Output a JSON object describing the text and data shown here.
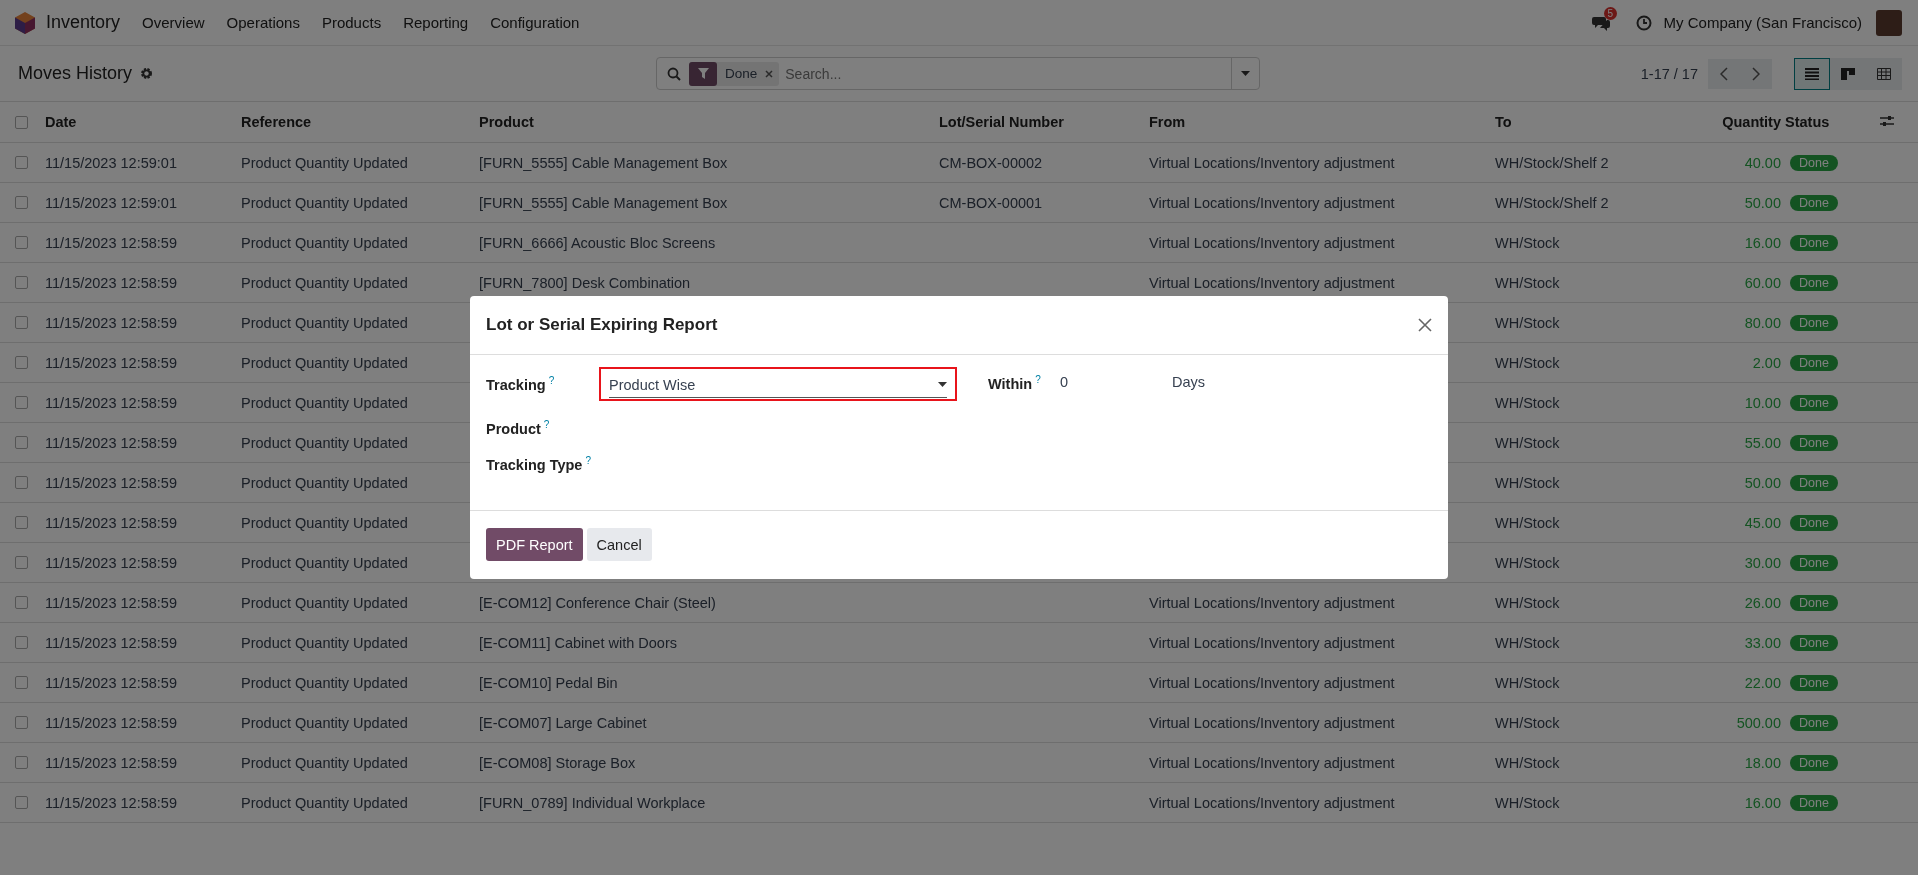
{
  "navbar": {
    "app_name": "Inventory",
    "menu": [
      "Overview",
      "Operations",
      "Products",
      "Reporting",
      "Configuration"
    ],
    "chat_count": "5",
    "company": "My Company (San Francisco)"
  },
  "control_panel": {
    "title": "Moves History",
    "search": {
      "facet": "Done",
      "placeholder": "Search..."
    },
    "pager": "1-17 / 17",
    "views": [
      {
        "kind": "list",
        "selected": true
      },
      {
        "kind": "kanban",
        "selected": false
      },
      {
        "kind": "pivot",
        "selected": false
      }
    ]
  },
  "table": {
    "all_checked": false,
    "columns": [
      "Date",
      "Reference",
      "Product",
      "Lot/Serial Number",
      "From",
      "To",
      "Quantity",
      "Status"
    ],
    "rows": [
      {
        "checked": false,
        "date": "11/15/2023 12:59:01",
        "reference": "Product Quantity Updated",
        "product": "[FURN_5555] Cable Management Box",
        "lot": "CM-BOX-00002",
        "from": "Virtual Locations/Inventory adjustment",
        "to": "WH/Stock/Shelf 2",
        "quantity": "40.00",
        "status": "Done"
      },
      {
        "checked": false,
        "date": "11/15/2023 12:59:01",
        "reference": "Product Quantity Updated",
        "product": "[FURN_5555] Cable Management Box",
        "lot": "CM-BOX-00001",
        "from": "Virtual Locations/Inventory adjustment",
        "to": "WH/Stock/Shelf 2",
        "quantity": "50.00",
        "status": "Done"
      },
      {
        "checked": false,
        "date": "11/15/2023 12:58:59",
        "reference": "Product Quantity Updated",
        "product": "[FURN_6666] Acoustic Bloc Screens",
        "from": "Virtual Locations/Inventory adjustment",
        "to": "WH/Stock",
        "quantity": "16.00",
        "status": "Done"
      },
      {
        "checked": false,
        "date": "11/15/2023 12:58:59",
        "reference": "Product Quantity Updated",
        "product": "[FURN_7800] Desk Combination",
        "from": "Virtual Locations/Inventory adjustment",
        "to": "WH/Stock",
        "quantity": "60.00",
        "status": "Done"
      },
      {
        "checked": false,
        "date": "11/15/2023 12:58:59",
        "reference": "Product Quantity Updated",
        "to": "WH/Stock",
        "quantity": "80.00",
        "status": "Done"
      },
      {
        "checked": false,
        "date": "11/15/2023 12:58:59",
        "reference": "Product Quantity Updated",
        "to": "WH/Stock",
        "quantity": "2.00",
        "status": "Done"
      },
      {
        "checked": false,
        "date": "11/15/2023 12:58:59",
        "reference": "Product Quantity Updated",
        "to": "WH/Stock",
        "quantity": "10.00",
        "status": "Done"
      },
      {
        "checked": false,
        "date": "11/15/2023 12:58:59",
        "reference": "Product Quantity Updated",
        "to": "WH/Stock",
        "quantity": "55.00",
        "status": "Done"
      },
      {
        "checked": false,
        "date": "11/15/2023 12:58:59",
        "reference": "Product Quantity Updated",
        "to": "WH/Stock",
        "quantity": "50.00",
        "status": "Done"
      },
      {
        "checked": false,
        "date": "11/15/2023 12:58:59",
        "reference": "Product Quantity Updated",
        "to": "WH/Stock",
        "quantity": "45.00",
        "status": "Done"
      },
      {
        "checked": false,
        "date": "11/15/2023 12:58:59",
        "reference": "Product Quantity Updated",
        "to": "WH/Stock",
        "quantity": "30.00",
        "status": "Done"
      },
      {
        "checked": false,
        "date": "11/15/2023 12:58:59",
        "reference": "Product Quantity Updated",
        "product": "[E-COM12] Conference Chair (Steel)",
        "from": "Virtual Locations/Inventory adjustment",
        "to": "WH/Stock",
        "quantity": "26.00",
        "status": "Done"
      },
      {
        "checked": false,
        "date": "11/15/2023 12:58:59",
        "reference": "Product Quantity Updated",
        "product": "[E-COM11] Cabinet with Doors",
        "from": "Virtual Locations/Inventory adjustment",
        "to": "WH/Stock",
        "quantity": "33.00",
        "status": "Done"
      },
      {
        "checked": false,
        "date": "11/15/2023 12:58:59",
        "reference": "Product Quantity Updated",
        "product": "[E-COM10] Pedal Bin",
        "from": "Virtual Locations/Inventory adjustment",
        "to": "WH/Stock",
        "quantity": "22.00",
        "status": "Done"
      },
      {
        "checked": false,
        "date": "11/15/2023 12:58:59",
        "reference": "Product Quantity Updated",
        "product": "[E-COM07] Large Cabinet",
        "from": "Virtual Locations/Inventory adjustment",
        "to": "WH/Stock",
        "quantity": "500.00",
        "status": "Done"
      },
      {
        "checked": false,
        "date": "11/15/2023 12:58:59",
        "reference": "Product Quantity Updated",
        "product": "[E-COM08] Storage Box",
        "from": "Virtual Locations/Inventory adjustment",
        "to": "WH/Stock",
        "quantity": "18.00",
        "status": "Done"
      },
      {
        "checked": false,
        "date": "11/15/2023 12:58:59",
        "reference": "Product Quantity Updated",
        "product": "[FURN_0789] Individual Workplace",
        "from": "Virtual Locations/Inventory adjustment",
        "to": "WH/Stock",
        "quantity": "16.00",
        "status": "Done"
      }
    ]
  },
  "dialog": {
    "title": "Lot or Serial Expiring Report",
    "fields": [
      {
        "label": "Tracking",
        "help": "?",
        "value": "Product Wise",
        "highlighted": true
      },
      {
        "label": "Product",
        "help": "?"
      },
      {
        "label": "Tracking Type",
        "help": "?"
      }
    ],
    "within": {
      "label": "Within",
      "help": "?",
      "value": "0",
      "unit": "Days"
    },
    "buttons": [
      {
        "label": "PDF Report",
        "kind": "primary"
      },
      {
        "label": "Cancel",
        "kind": "secondary"
      }
    ]
  }
}
